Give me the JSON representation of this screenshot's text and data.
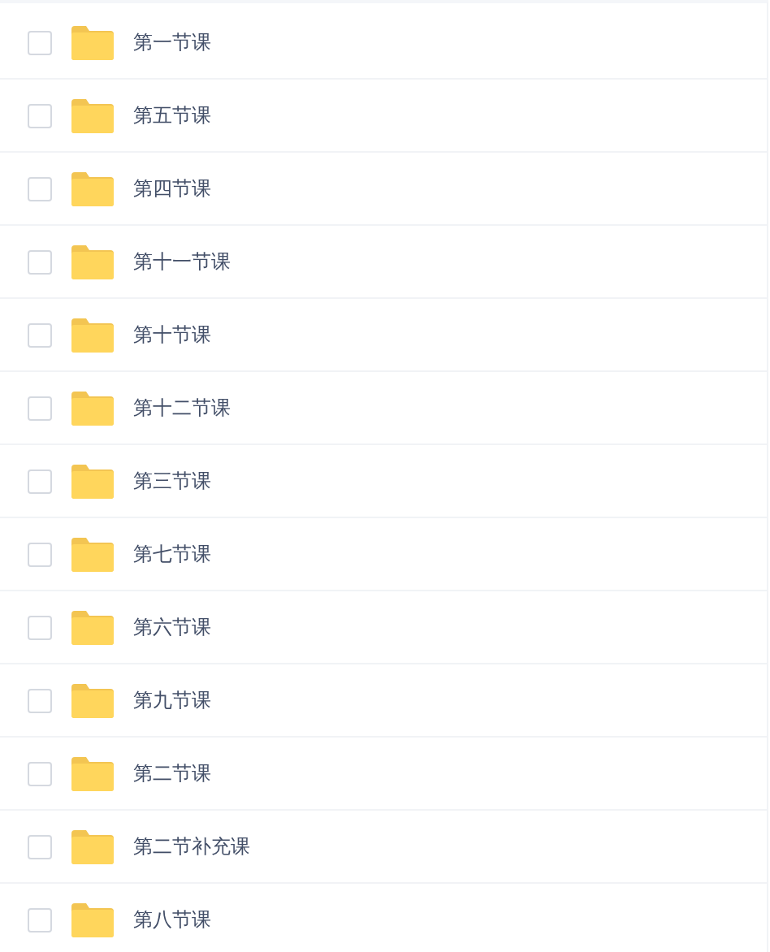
{
  "files": [
    {
      "name": "第一节课",
      "checked": false
    },
    {
      "name": "第五节课",
      "checked": false
    },
    {
      "name": "第四节课",
      "checked": false
    },
    {
      "name": "第十一节课",
      "checked": false
    },
    {
      "name": "第十节课",
      "checked": false
    },
    {
      "name": "第十二节课",
      "checked": false
    },
    {
      "name": "第三节课",
      "checked": false
    },
    {
      "name": "第七节课",
      "checked": false
    },
    {
      "name": "第六节课",
      "checked": false
    },
    {
      "name": "第九节课",
      "checked": false
    },
    {
      "name": "第二节课",
      "checked": false
    },
    {
      "name": "第二节补充课",
      "checked": false
    },
    {
      "name": "第八节课",
      "checked": false
    }
  ]
}
